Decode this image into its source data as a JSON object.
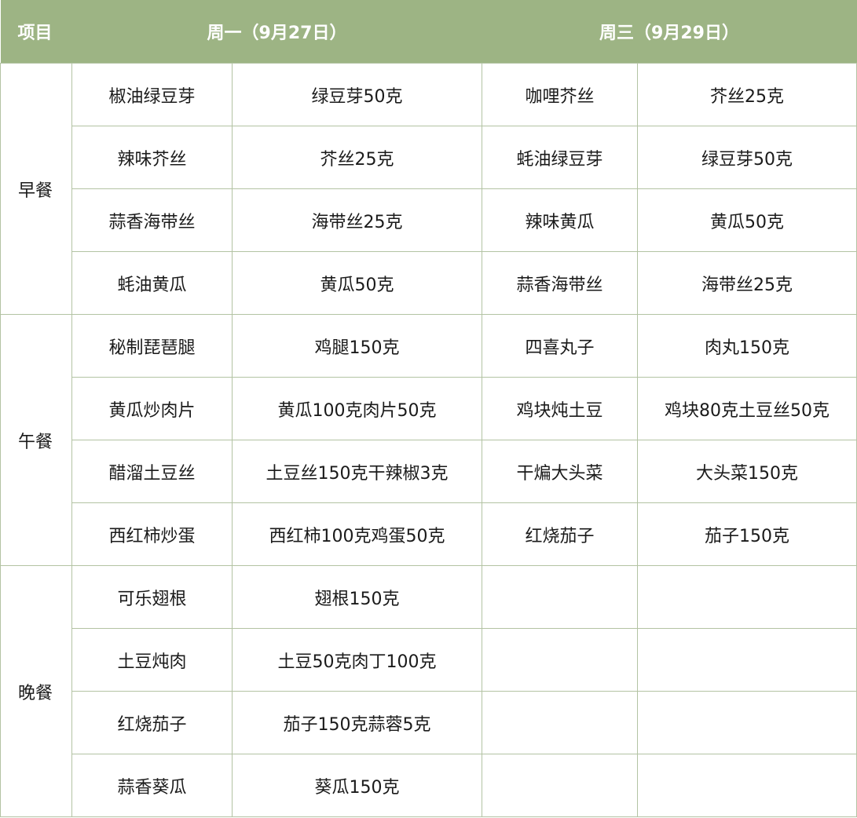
{
  "table": {
    "header": {
      "item": "项目",
      "monday": "周一（9月27日）",
      "wednesday": "周三（9月29日）"
    },
    "meals": [
      {
        "name": "早餐",
        "rows": [
          {
            "mon_dish": "椒油绿豆芽",
            "mon_ingredients": "绿豆芽50克",
            "wed_dish": "咖哩芥丝",
            "wed_ingredients": "芥丝25克"
          },
          {
            "mon_dish": "辣味芥丝",
            "mon_ingredients": "芥丝25克",
            "wed_dish": "蚝油绿豆芽",
            "wed_ingredients": "绿豆芽50克"
          },
          {
            "mon_dish": "蒜香海带丝",
            "mon_ingredients": "海带丝25克",
            "wed_dish": "辣味黄瓜",
            "wed_ingredients": "黄瓜50克"
          },
          {
            "mon_dish": "蚝油黄瓜",
            "mon_ingredients": "黄瓜50克",
            "wed_dish": "蒜香海带丝",
            "wed_ingredients": "海带丝25克"
          }
        ]
      },
      {
        "name": "午餐",
        "rows": [
          {
            "mon_dish": "秘制琵琶腿",
            "mon_ingredients": "鸡腿150克",
            "wed_dish": "四喜丸子",
            "wed_ingredients": "肉丸150克"
          },
          {
            "mon_dish": "黄瓜炒肉片",
            "mon_ingredients": "黄瓜100克肉片50克",
            "wed_dish": "鸡块炖土豆",
            "wed_ingredients": "鸡块80克土豆丝50克"
          },
          {
            "mon_dish": "醋溜土豆丝",
            "mon_ingredients": "土豆丝150克干辣椒3克",
            "wed_dish": "干煸大头菜",
            "wed_ingredients": "大头菜150克"
          },
          {
            "mon_dish": "西红柿炒蛋",
            "mon_ingredients": "西红柿100克鸡蛋50克",
            "wed_dish": "红烧茄子",
            "wed_ingredients": "茄子150克"
          }
        ]
      },
      {
        "name": "晚餐",
        "rows": [
          {
            "mon_dish": "可乐翅根",
            "mon_ingredients": "翅根150克",
            "wed_dish": "",
            "wed_ingredients": ""
          },
          {
            "mon_dish": "土豆炖肉",
            "mon_ingredients": "土豆50克肉丁100克",
            "wed_dish": "",
            "wed_ingredients": ""
          },
          {
            "mon_dish": "红烧茄子",
            "mon_ingredients": "茄子150克蒜蓉5克",
            "wed_dish": "",
            "wed_ingredients": ""
          },
          {
            "mon_dish": "蒜香葵瓜",
            "mon_ingredients": "葵瓜150克",
            "wed_dish": "",
            "wed_ingredients": ""
          }
        ]
      }
    ]
  },
  "colors": {
    "header_bg": "#9db484",
    "header_text": "#ffffff",
    "grid_line": "#b3c3a3",
    "body_text": "#1a1a1a"
  }
}
